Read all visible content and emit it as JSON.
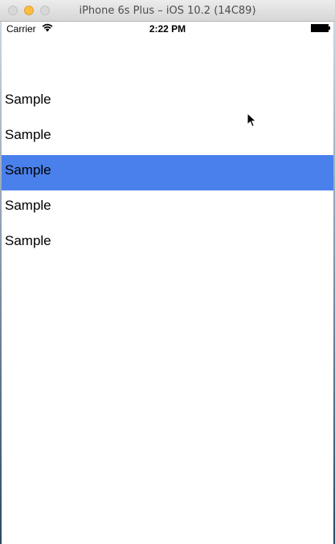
{
  "window": {
    "title": "iPhone 6s Plus – iOS 10.2 (14C89)",
    "min_button_color": "#fdbc40"
  },
  "statusbar": {
    "carrier": "Carrier",
    "time": "2:22 PM",
    "wifi_icon": "wifi-icon",
    "battery_icon": "battery-icon"
  },
  "list": {
    "selected_index": 2,
    "selected_color": "#4a80ec",
    "items": [
      {
        "label": "Sample"
      },
      {
        "label": "Sample"
      },
      {
        "label": "Sample"
      },
      {
        "label": "Sample"
      },
      {
        "label": "Sample"
      }
    ]
  },
  "cursor_icon": "arrow-cursor-icon"
}
